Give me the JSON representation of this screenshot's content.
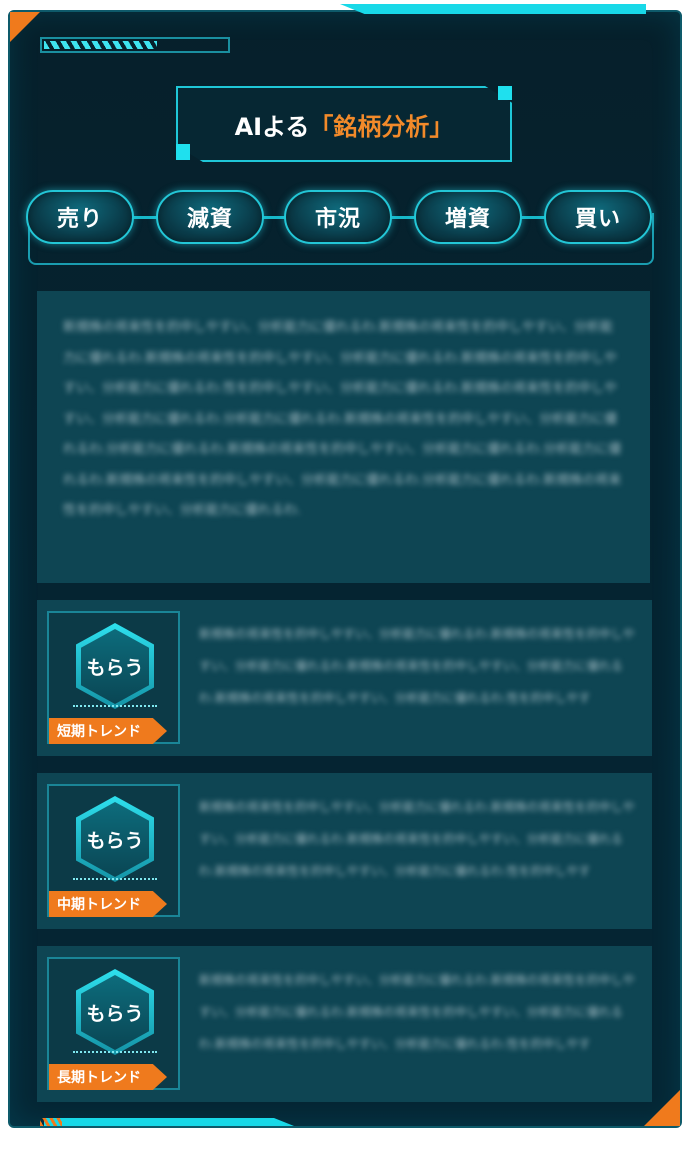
{
  "header": {
    "title_prefix": "AIよる",
    "title_accent": "「銘柄分析」"
  },
  "progress": {
    "value": 0.62
  },
  "tabs": [
    {
      "label": "売り"
    },
    {
      "label": "減資"
    },
    {
      "label": "市況"
    },
    {
      "label": "増資"
    },
    {
      "label": "買い"
    }
  ],
  "description": "新規株の将来性を的中しやすい、分析能力に優れるわ.新規株の将来性を的中しやすい、分析能力に優れるわ.新規株の将来性を的中しやすい、分析能力に優れるわ.新規株の将来性を的中しやすい、分析能力に優れるわ.性を的中しやすい、分析能力に優れるわ.新規株の将来性を的中しやすい、分析能力に優れるわ.分析能力に優れるわ.新規株の将来性を的中しやすい、分析能力に優れるわ.分析能力に優れるわ.新規株の将来性を的中しやすい、分析能力に優れるわ.分析能力に優れるわ.新規株の将来性を的中しやすい、分析能力に優れるわ.分析能力に優れるわ.新規株の将来性を的中しやすい、分析能力に優れるわ.",
  "cards": [
    {
      "badge": "もらう",
      "tag": "短期トレンド",
      "text": "新規株の将来性を的中しやすい、分析能力に優れるわ.新規株の将来性を的中しやすい、分析能力に優れるわ.新規株の将来性を的中しやすい、分析能力に優れるわ.新規株の将来性を的中しやすい、分析能力に優れるわ.性を的中しやす"
    },
    {
      "badge": "もらう",
      "tag": "中期トレンド",
      "text": "新規株の将来性を的中しやすい、分析能力に優れるわ.新規株の将来性を的中しやすい、分析能力に優れるわ.新規株の将来性を的中しやすい、分析能力に優れるわ.新規株の将来性を的中しやすい、分析能力に優れるわ.性を的中しやす"
    },
    {
      "badge": "もらう",
      "tag": "長期トレンド",
      "text": "新規株の将来性を的中しやすい、分析能力に優れるわ.新規株の将来性を的中しやすい、分析能力に優れるわ.新規株の将来性を的中しやすい、分析能力に優れるわ.新規株の将来性を的中しやすい、分析能力に優れるわ.性を的中しやす"
    }
  ],
  "colors": {
    "accent": "#f07a1c",
    "cyan": "#1fc7d8",
    "panel": "#06202b",
    "card": "#0e4553"
  }
}
